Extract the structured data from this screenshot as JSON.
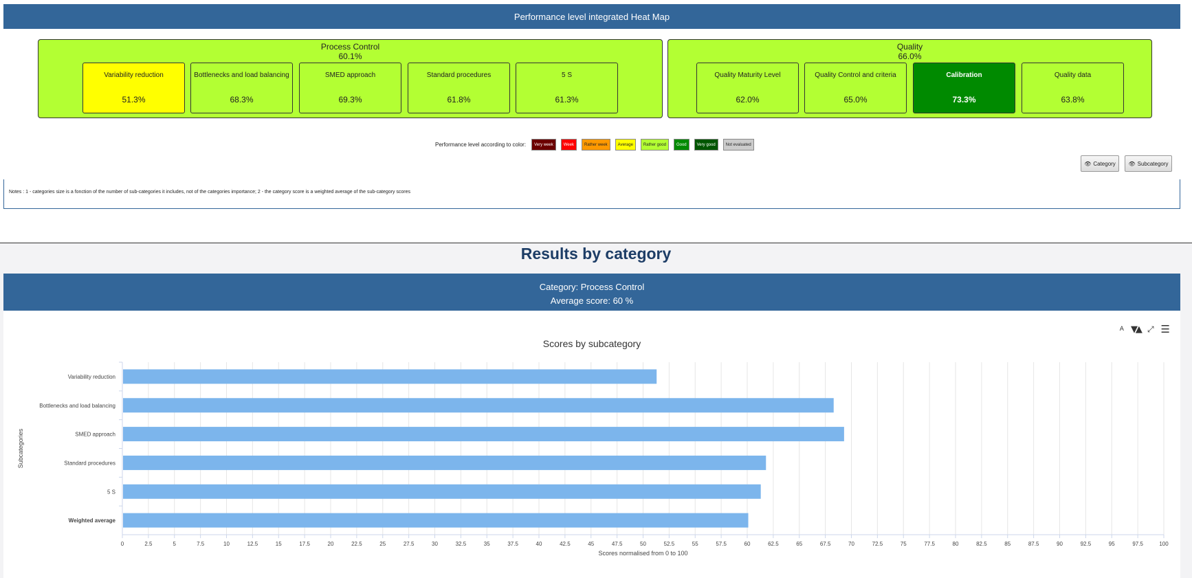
{
  "heatmap": {
    "title": "Performance level integrated Heat Map",
    "categories": [
      {
        "name": "Process Control",
        "score": "60.1%",
        "color": "#b3ff33",
        "subcategories": [
          {
            "label": "Variability reduction",
            "value": "51.3%",
            "color": "#ffff00"
          },
          {
            "label": "Bottlenecks and load balancing",
            "value": "68.3%",
            "color": "#b3ff33"
          },
          {
            "label": "SMED approach",
            "value": "69.3%",
            "color": "#b3ff33"
          },
          {
            "label": "Standard procedures",
            "value": "61.8%",
            "color": "#b3ff33"
          },
          {
            "label": "5 S",
            "value": "61.3%",
            "color": "#b3ff33"
          }
        ]
      },
      {
        "name": "Quality",
        "score": "66.0%",
        "color": "#b3ff33",
        "subcategories": [
          {
            "label": "Quality Maturity Level",
            "value": "62.0%",
            "color": "#b3ff33"
          },
          {
            "label": "Quality Control and criteria",
            "value": "65.0%",
            "color": "#b3ff33"
          },
          {
            "label": "Calibration",
            "value": "73.3%",
            "color": "#008a00"
          },
          {
            "label": "Quality data",
            "value": "63.8%",
            "color": "#b3ff33"
          }
        ]
      }
    ],
    "legend": {
      "title": "Performance level according to color:",
      "items": [
        {
          "label": "Very week",
          "color": "#6b0000",
          "text_color": "#ffffff"
        },
        {
          "label": "Week",
          "color": "#ff0000",
          "text_color": "#ffffff"
        },
        {
          "label": "Rather week",
          "color": "#ff9900",
          "text_color": "#222222"
        },
        {
          "label": "Average",
          "color": "#ffff00",
          "text_color": "#222222"
        },
        {
          "label": "Rather good",
          "color": "#b3ff33",
          "text_color": "#222222"
        },
        {
          "label": "Good",
          "color": "#008a00",
          "text_color": "#ffffff"
        },
        {
          "label": "Very good",
          "color": "#005500",
          "text_color": "#ffffff"
        },
        {
          "label": "Not evaluated",
          "color": "#cccccc",
          "text_color": "#222222"
        }
      ]
    },
    "buttons": {
      "category": "Category",
      "subcategory": "Subcategory"
    },
    "notes": "Notes : 1 - categories size is a fonction of the number of sub-categories it includes, not of the categories importance; 2 - the category score is a weighted average of the sub-category scores"
  },
  "results": {
    "section_title": "Results by category",
    "category_line": "Category: Process Control",
    "average_line": "Average score: 60 %"
  },
  "chart_data": {
    "type": "bar",
    "orientation": "horizontal",
    "title": "Scores by subcategory",
    "xlabel": "Scores normalised from 0 to 100",
    "ylabel": "Subcategories",
    "categories": [
      "Variability reduction",
      "Bottlenecks and load balancing",
      "SMED approach",
      "Standard procedures",
      "5 S",
      "Weighted average"
    ],
    "values": [
      51.3,
      68.3,
      69.3,
      61.8,
      61.3,
      60.1
    ],
    "xlim": [
      0,
      100
    ],
    "xticks": [
      "0",
      "2.5",
      "5",
      "7.5",
      "10",
      "12.5",
      "15",
      "17.5",
      "20",
      "22.5",
      "25",
      "27.5",
      "30",
      "32.5",
      "35",
      "37.5",
      "40",
      "42.5",
      "45",
      "47.5",
      "50",
      "52.5",
      "55",
      "57.5",
      "60",
      "62.5",
      "65",
      "67.5",
      "70",
      "72.5",
      "75",
      "77.5",
      "80",
      "82.5",
      "85",
      "87.5",
      "90",
      "92.5",
      "95",
      "97.5",
      "100"
    ],
    "bar_color": "#7cb5ec",
    "grid": true,
    "bold_categories": [
      "Weighted average"
    ]
  }
}
